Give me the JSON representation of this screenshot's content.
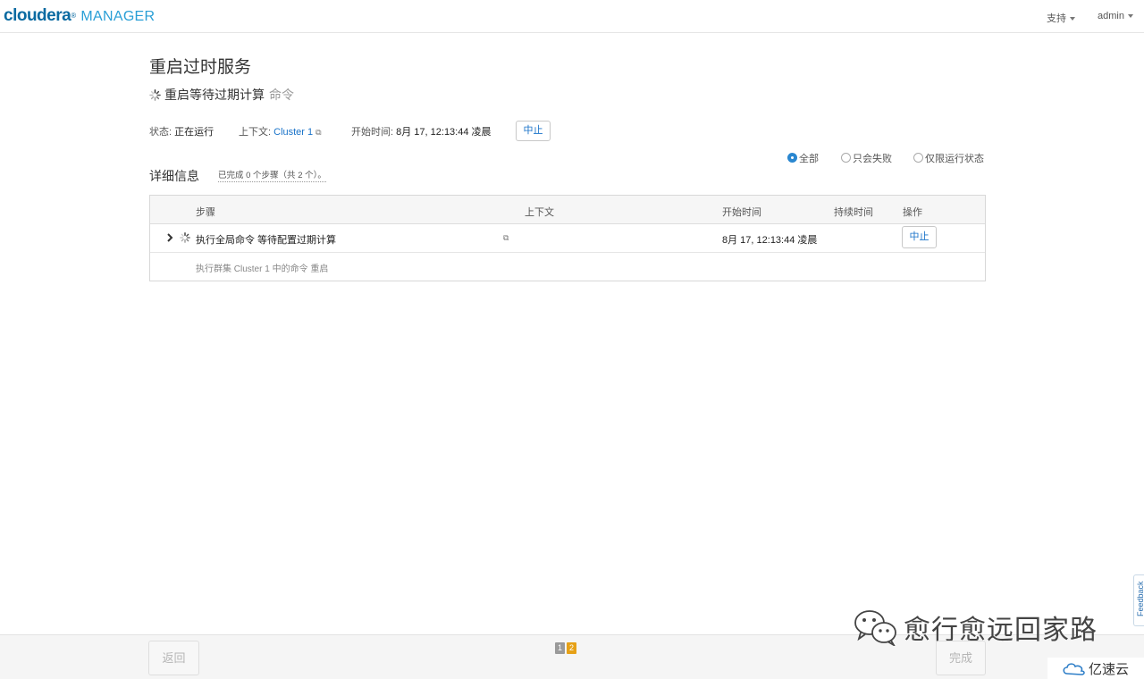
{
  "header": {
    "logo_brand": "cloudera",
    "logo_product": "MANAGER",
    "nav_support": "支持",
    "nav_user": "admin"
  },
  "page": {
    "title": "重启过时服务",
    "command_name": "重启等待过期计算",
    "command_suffix": "命令"
  },
  "status": {
    "state_label": "状态:",
    "state_value": "正在运行",
    "context_label": "上下文:",
    "context_value": "Cluster 1",
    "start_label": "开始时间:",
    "start_value": "8月 17, 12:13:44 凌晨",
    "abort_label": "中止"
  },
  "filters": {
    "options": [
      "全部",
      "只会失败",
      "仅限运行状态"
    ],
    "selected": "全部"
  },
  "details": {
    "label": "详细信息",
    "summary": "已完成 0 个步骤（共 2 个）。"
  },
  "table": {
    "headers": {
      "step": "步骤",
      "context": "上下文",
      "start_time": "开始时间",
      "duration": "持续时间",
      "actions": "操作"
    },
    "rows": [
      {
        "step": "执行全局命令 等待配置过期计算",
        "start_time": "8月 17, 12:13:44 凌晨",
        "duration": "",
        "action": "中止"
      }
    ],
    "sub_row": "执行群集 Cluster 1 中的命令 重启"
  },
  "footer": {
    "back_label": "返回",
    "done_label": "完成",
    "pages": [
      "1",
      "2"
    ],
    "current_page": "2"
  },
  "feedback_label": "Feedback",
  "watermark": {
    "text": "愈行愈远回家路",
    "site": "亿速云"
  },
  "colors": {
    "brand": "#0a6aa1",
    "link": "#1a73c9",
    "pager_active": "#e6a117",
    "radio_checked": "#2a87d0"
  }
}
